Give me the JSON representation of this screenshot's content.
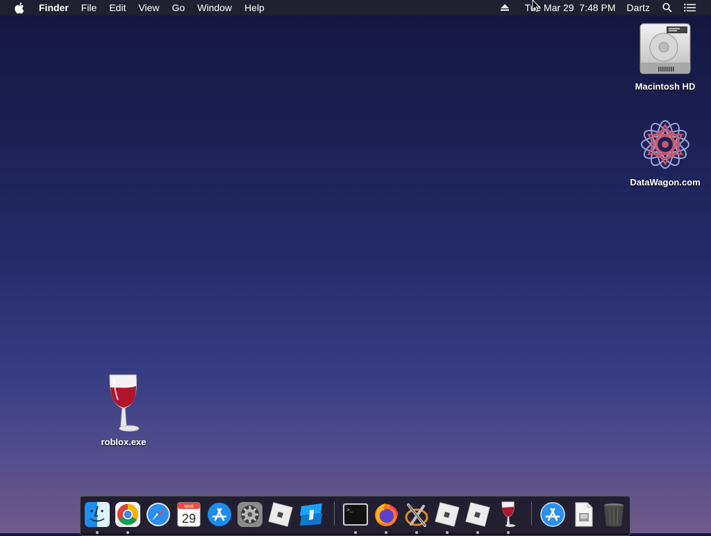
{
  "menubar": {
    "apple_icon": "apple-logo-icon",
    "app_name": "Finder",
    "menus": [
      "File",
      "Edit",
      "View",
      "Go",
      "Window",
      "Help"
    ],
    "eject_icon": "eject-icon",
    "datetime": "Tue Mar 29  7:48 PM",
    "user": "Dartz",
    "search_icon": "spotlight-search-icon",
    "notifications_icon": "notification-center-icon"
  },
  "desktop": {
    "icons": [
      {
        "label": "Macintosh HD",
        "icon": "hard-drive-icon"
      },
      {
        "label": "DataWagon.com",
        "icon": "network-drive-icon"
      },
      {
        "label": "roblox.exe",
        "icon": "wine-glass-icon"
      }
    ]
  },
  "dock": {
    "apps": [
      {
        "name": "Finder",
        "icon": "finder-icon",
        "running": true
      },
      {
        "name": "Google Chrome",
        "icon": "chrome-icon",
        "running": true
      },
      {
        "name": "Safari",
        "icon": "safari-icon",
        "running": false
      },
      {
        "name": "Calendar",
        "icon": "calendar-icon",
        "running": false,
        "month": "MAR",
        "day": "29"
      },
      {
        "name": "App Store",
        "icon": "app-store-icon",
        "running": false
      },
      {
        "name": "System Preferences",
        "icon": "gear-icon",
        "running": false
      },
      {
        "name": "Roblox",
        "icon": "roblox-icon",
        "running": false
      },
      {
        "name": "Roblox Studio",
        "icon": "roblox-studio-icon",
        "running": false
      },
      {
        "name": "Terminal",
        "icon": "terminal-icon",
        "running": true
      },
      {
        "name": "Firefox",
        "icon": "firefox-icon",
        "running": true
      },
      {
        "name": "XQuartz",
        "icon": "xquartz-icon",
        "running": true
      },
      {
        "name": "Roblox",
        "icon": "roblox-icon",
        "running": true
      },
      {
        "name": "Roblox",
        "icon": "roblox-icon",
        "running": true
      },
      {
        "name": "Wine",
        "icon": "wine-glass-icon",
        "running": true
      },
      {
        "name": "Applications",
        "icon": "applications-folder-icon",
        "running": false
      },
      {
        "name": "Document",
        "icon": "document-icon",
        "running": false
      },
      {
        "name": "Trash",
        "icon": "trash-icon",
        "running": false
      }
    ],
    "terminal_prompt": ">_"
  },
  "colors": {
    "menubar_bg": "#1f2030",
    "wallpaper_top": "#14153c",
    "wallpaper_bottom": "#6f5c88",
    "wine_red": "#b0152b"
  }
}
